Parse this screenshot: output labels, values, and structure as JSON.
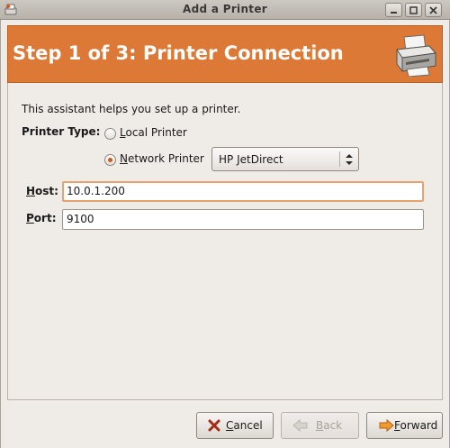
{
  "window": {
    "title": "Add a Printer"
  },
  "header": {
    "heading": "Step 1 of 3: Printer Connection"
  },
  "content": {
    "intro": "This assistant helps you set up a printer.",
    "printer_type_label": "Printer Type:",
    "local_option": {
      "label": "Local Printer",
      "checked": false
    },
    "network_option": {
      "label": "Network Printer",
      "checked": true
    },
    "network_type": {
      "selected": "HP JetDirect"
    },
    "host_label": "Host:",
    "host_value": "10.0.1.200",
    "port_label": "Port:",
    "port_value": "9100"
  },
  "buttons": {
    "cancel": "Cancel",
    "back": "Back",
    "forward": "Forward"
  },
  "colors": {
    "accent": "#dd7936",
    "window_bg": "#efebe7"
  },
  "icons": {
    "banner": "printer-icon",
    "cancel": "x-icon",
    "back": "arrow-left-icon",
    "forward": "arrow-right-icon"
  }
}
